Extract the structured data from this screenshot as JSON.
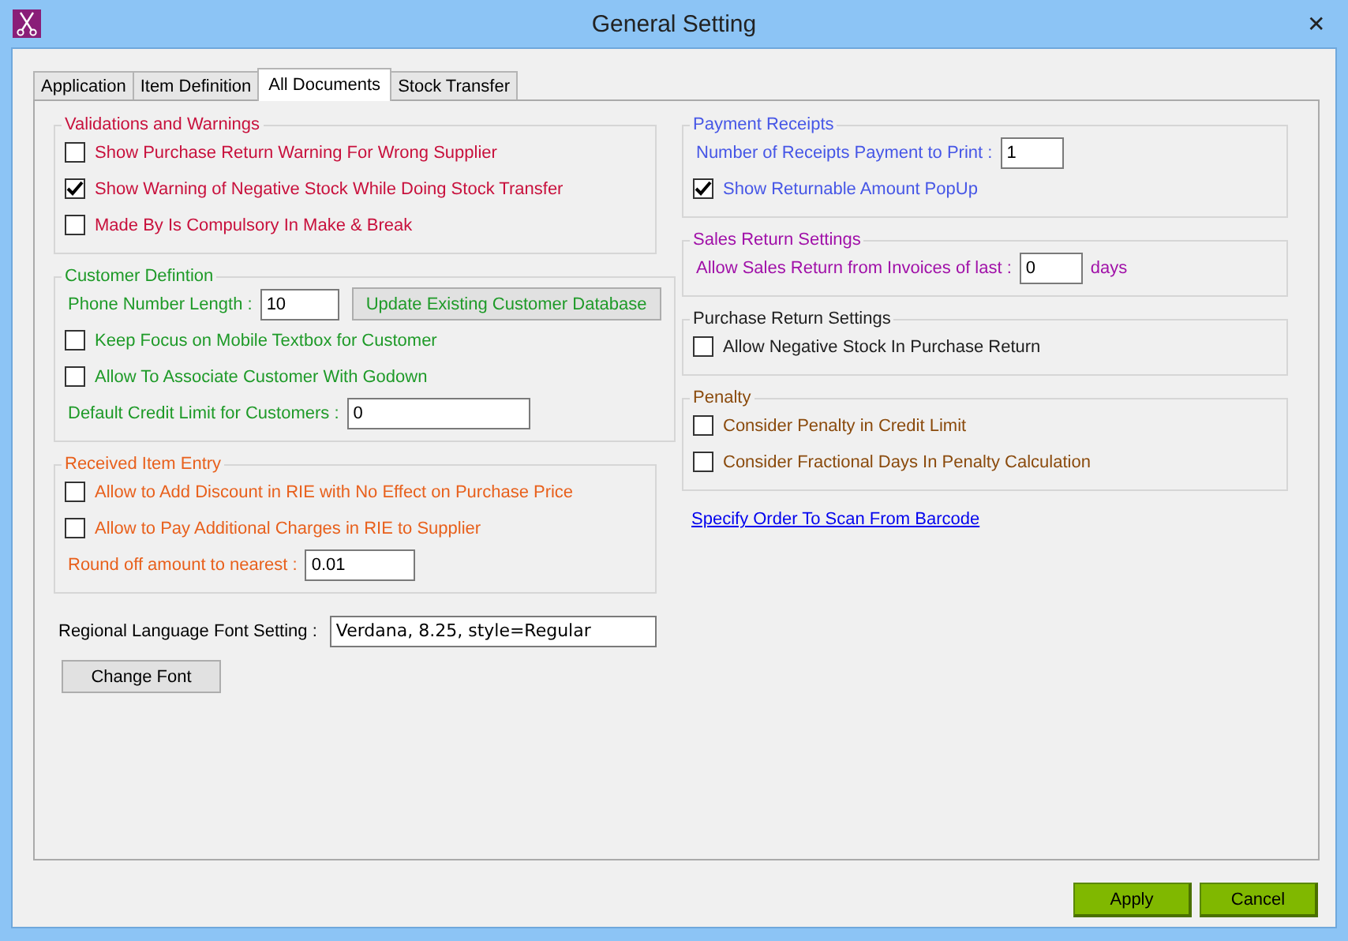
{
  "window": {
    "title": "General Setting",
    "close": "✕"
  },
  "tabs": [
    {
      "label": "Application",
      "selected": false
    },
    {
      "label": "Item Definition",
      "selected": false
    },
    {
      "label": "All Documents",
      "selected": true
    },
    {
      "label": "Stock Transfer",
      "selected": false
    }
  ],
  "left_groups": [
    {
      "title": "Validations and Warnings",
      "color": "#c8103c",
      "rows": [
        {
          "kind": "checkbox",
          "label": "Show Purchase Return Warning For Wrong Supplier",
          "checked": false
        },
        {
          "kind": "checkbox",
          "label": "Show Warning of Negative Stock While Doing Stock Transfer",
          "checked": true
        },
        {
          "kind": "checkbox",
          "label": "Made By Is Compulsory In Make & Break",
          "checked": false
        }
      ]
    },
    {
      "title": "Customer Defintion",
      "color": "#1e9a28",
      "rows": [
        {
          "kind": "field",
          "label": "Phone Number Length :",
          "value": "10",
          "button": "Update Existing Customer Database"
        },
        {
          "kind": "checkbox",
          "label": "Keep Focus on Mobile Textbox for Customer",
          "checked": false
        },
        {
          "kind": "checkbox",
          "label": "Allow To Associate Customer With Godown",
          "checked": false
        },
        {
          "kind": "field",
          "label": "Default Credit Limit  for Customers :",
          "value": "0"
        }
      ]
    },
    {
      "title": "Received Item Entry",
      "color": "#e8601c",
      "rows": [
        {
          "kind": "checkbox",
          "label": "Allow to Add Discount in RIE with No Effect on Purchase Price",
          "checked": false
        },
        {
          "kind": "checkbox",
          "label": "Allow to Pay Additional Charges in RIE to Supplier",
          "checked": false
        },
        {
          "kind": "field",
          "label": "Round off amount to nearest :",
          "value": "0.01"
        }
      ]
    }
  ],
  "font_setting": {
    "label": "Regional Language Font Setting :",
    "value": "Verdana, 8.25, style=Regular",
    "button": "Change Font"
  },
  "right_groups": [
    {
      "title": "Payment Receipts",
      "color": "#4656e6",
      "rows": [
        {
          "kind": "field",
          "label": "Number of Receipts Payment to Print :",
          "value": "1"
        },
        {
          "kind": "checkbox",
          "label": "Show Returnable Amount PopUp",
          "checked": true
        }
      ]
    },
    {
      "title": "Sales Return Settings",
      "color": "#a010a8",
      "rows": [
        {
          "kind": "field",
          "label": "Allow Sales Return from Invoices of last :",
          "value": "0",
          "suffix": "days"
        }
      ]
    },
    {
      "title": "Purchase Return Settings",
      "color": "#202020",
      "rows": [
        {
          "kind": "checkbox",
          "label": "Allow Negative Stock In Purchase Return",
          "checked": false
        }
      ]
    },
    {
      "title": "Penalty",
      "color": "#8a4a0c",
      "rows": [
        {
          "kind": "checkbox",
          "label": "Consider Penalty in Credit Limit",
          "checked": false
        },
        {
          "kind": "checkbox",
          "label": "Consider Fractional Days In Penalty Calculation",
          "checked": false
        }
      ]
    }
  ],
  "link": "Specify Order To Scan From Barcode",
  "buttons": [
    "Apply",
    "Cancel"
  ]
}
